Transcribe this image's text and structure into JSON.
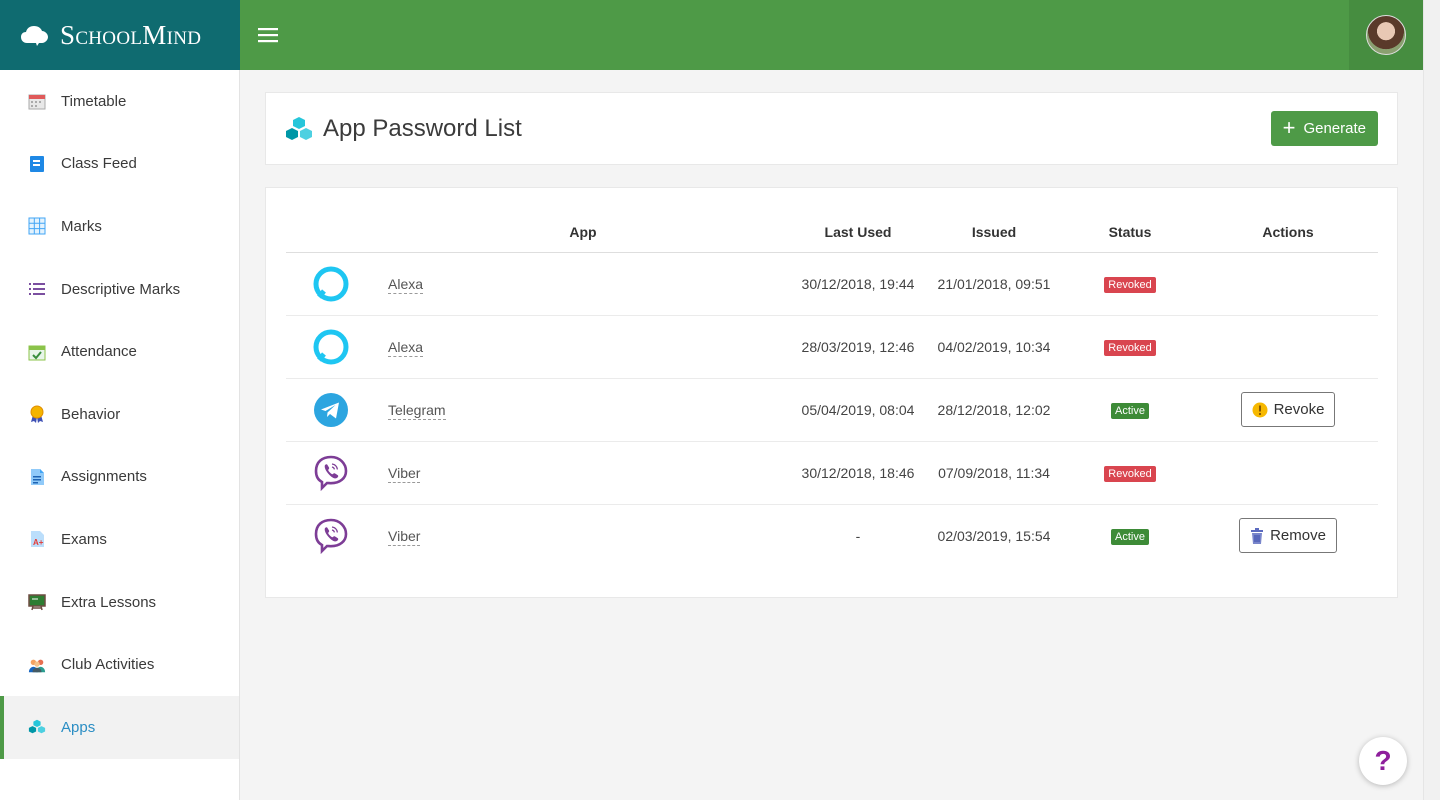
{
  "brand": {
    "name": "SchoolMind"
  },
  "topbar": {
    "menu_icon": "hamburger-icon",
    "avatar": "user-avatar"
  },
  "sidebar": {
    "items": [
      {
        "label": "Timetable",
        "icon": "calendar-icon"
      },
      {
        "label": "Class Feed",
        "icon": "notebook-icon"
      },
      {
        "label": "Marks",
        "icon": "grid-icon"
      },
      {
        "label": "Descriptive Marks",
        "icon": "list-icon"
      },
      {
        "label": "Attendance",
        "icon": "calendar-check-icon"
      },
      {
        "label": "Behavior",
        "icon": "medal-icon"
      },
      {
        "label": "Assignments",
        "icon": "document-icon"
      },
      {
        "label": "Exams",
        "icon": "exam-grade-icon"
      },
      {
        "label": "Extra Lessons",
        "icon": "blackboard-icon"
      },
      {
        "label": "Club Activities",
        "icon": "group-icon"
      },
      {
        "label": "Apps",
        "icon": "cubes-icon",
        "active": true
      }
    ]
  },
  "header": {
    "title": "App Password List",
    "generate_label": "Generate"
  },
  "table": {
    "columns": {
      "app": "App",
      "last_used": "Last Used",
      "issued": "Issued",
      "status": "Status",
      "actions": "Actions"
    },
    "rows": [
      {
        "app": "Alexa",
        "icon": "alexa-icon",
        "last_used": "30/12/2018, 19:44",
        "issued": "21/01/2018, 09:51",
        "status": "Revoked",
        "action": ""
      },
      {
        "app": "Alexa",
        "icon": "alexa-icon",
        "last_used": "28/03/2019, 12:46",
        "issued": "04/02/2019, 10:34",
        "status": "Revoked",
        "action": ""
      },
      {
        "app": "Telegram",
        "icon": "telegram-icon",
        "last_used": "05/04/2019, 08:04",
        "issued": "28/12/2018, 12:02",
        "status": "Active",
        "action": "Revoke"
      },
      {
        "app": "Viber",
        "icon": "viber-icon",
        "last_used": "30/12/2018, 18:46",
        "issued": "07/09/2018, 11:34",
        "status": "Revoked",
        "action": ""
      },
      {
        "app": "Viber",
        "icon": "viber-icon",
        "last_used": "-",
        "issued": "02/03/2019, 15:54",
        "status": "Active",
        "action": "Remove"
      }
    ]
  },
  "help": {
    "label": "?"
  },
  "colors": {
    "topbar": "#4e9a47",
    "brand": "#0f6b70",
    "revoked": "#d9454f",
    "active": "#3d8b37",
    "active_nav": "#2b8ec4"
  }
}
